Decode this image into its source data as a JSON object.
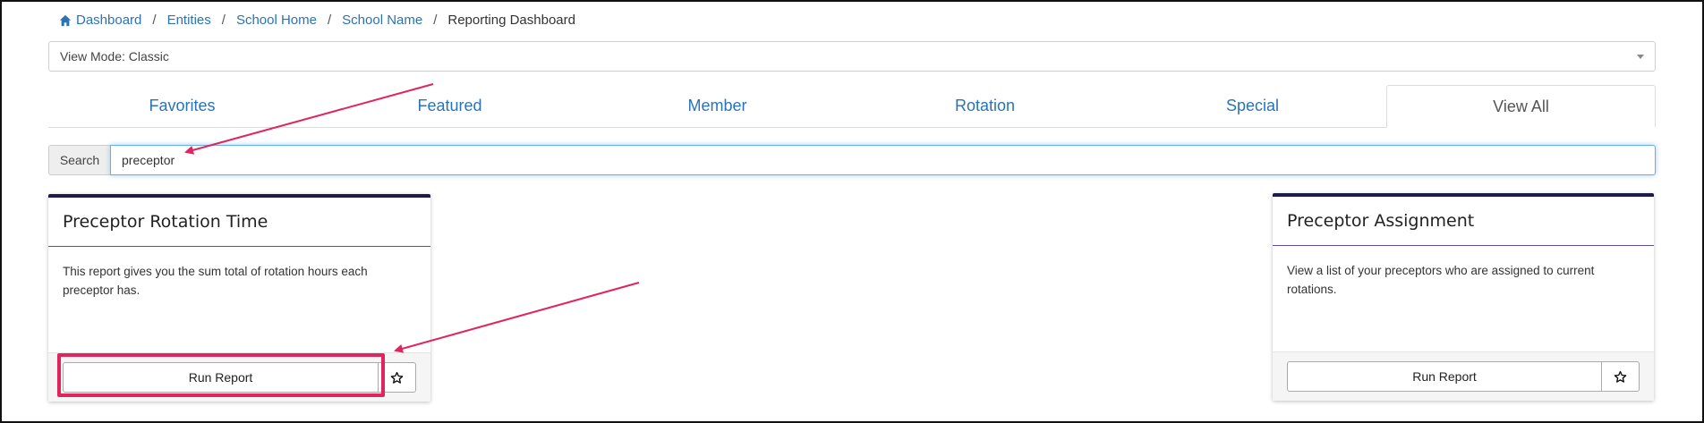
{
  "breadcrumb": {
    "items": [
      "Dashboard",
      "Entities",
      "School Home",
      "School Name"
    ],
    "separator": "/",
    "current": "Reporting Dashboard"
  },
  "view_mode": {
    "value": "View Mode: Classic"
  },
  "tabs": [
    {
      "label": "Favorites",
      "active": false
    },
    {
      "label": "Featured",
      "active": false
    },
    {
      "label": "Member",
      "active": false
    },
    {
      "label": "Rotation",
      "active": false
    },
    {
      "label": "Special",
      "active": false
    },
    {
      "label": "View All",
      "active": true
    }
  ],
  "search": {
    "label": "Search",
    "value": "preceptor"
  },
  "cards": [
    {
      "title": "Preceptor Rotation Time",
      "description": "This report gives you the sum total of rotation hours each preceptor has.",
      "run_label": "Run Report"
    },
    {
      "title": "Preceptor Assignment",
      "description": "View a list of your preceptors who are assigned to current rotations.",
      "run_label": "Run Report"
    }
  ],
  "colors": {
    "link": "#2b73b7",
    "card_accent": "#1c1b4a",
    "annotation": "#e0245e"
  },
  "icons": {
    "home": "home-icon",
    "star": "star-outline-icon",
    "caret": "chevron-down-icon"
  }
}
